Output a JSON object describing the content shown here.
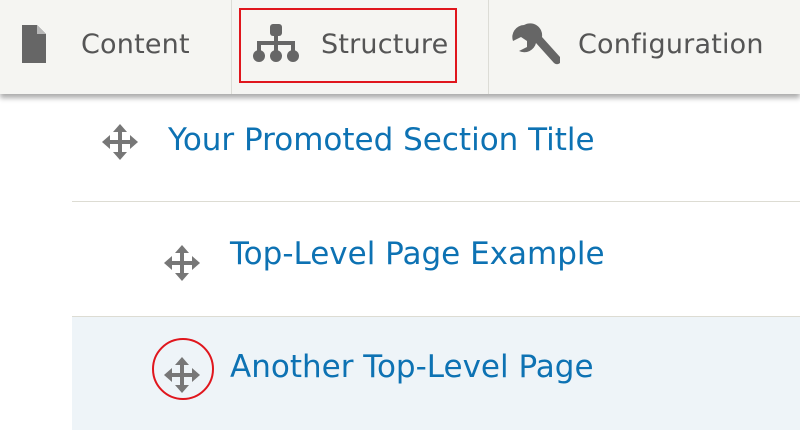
{
  "toolbar": {
    "tabs": [
      {
        "label": "Content",
        "icon": "file-icon"
      },
      {
        "label": "Structure",
        "icon": "sitemap-icon",
        "highlighted": true
      },
      {
        "label": "Configuration",
        "icon": "wrench-icon"
      }
    ]
  },
  "menu": {
    "items": [
      {
        "label": "Your Promoted Section Title",
        "depth": 0,
        "handle_icon": "drag-move-icon"
      },
      {
        "label": "Top-Level Page Example",
        "depth": 1,
        "handle_icon": "drag-move-icon"
      },
      {
        "label": "Another Top-Level Page",
        "depth": 1,
        "handle_icon": "drag-move-icon",
        "handle_highlighted": true
      }
    ]
  },
  "colors": {
    "toolbar_bg": "#f5f5f2",
    "tab_text": "#555555",
    "link": "#0d72b3",
    "highlight_red": "#e0161d",
    "selected_row_bg": "#eef4f8",
    "icon_gray": "#666666"
  }
}
